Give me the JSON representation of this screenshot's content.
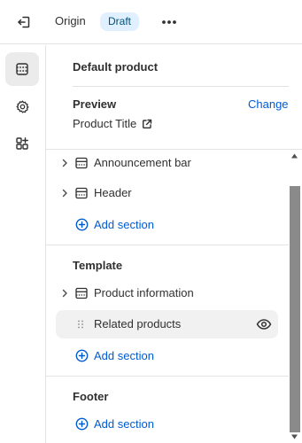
{
  "topbar": {
    "origin_label": "Origin",
    "status_badge": "Draft"
  },
  "icons": {
    "exit": "exit-icon",
    "more": "more-horizontal-icon",
    "sections": "sections-icon",
    "settings": "gear-icon",
    "apps": "apps-icon",
    "external": "external-link-icon",
    "section_block": "section-block-icon",
    "eye": "eye-icon",
    "plus": "plus-circle-icon",
    "drag": "drag-handle-icon"
  },
  "panel": {
    "title": "Default product",
    "preview": {
      "heading": "Preview",
      "change_label": "Change",
      "value": "Product Title"
    },
    "header_group": {
      "items": [
        {
          "label": "Announcement bar"
        },
        {
          "label": "Header"
        }
      ],
      "add_label": "Add section"
    },
    "template_group": {
      "heading": "Template",
      "items": [
        {
          "label": "Product information"
        },
        {
          "label": "Related products"
        }
      ],
      "add_label": "Add section"
    },
    "footer_group": {
      "heading": "Footer",
      "add_label": "Add section"
    }
  },
  "colors": {
    "accent": "#005bd3",
    "badge_bg": "#e0f0ff",
    "selected_bg": "#f1f1f1",
    "scrollbar": "#8a8a8a"
  }
}
